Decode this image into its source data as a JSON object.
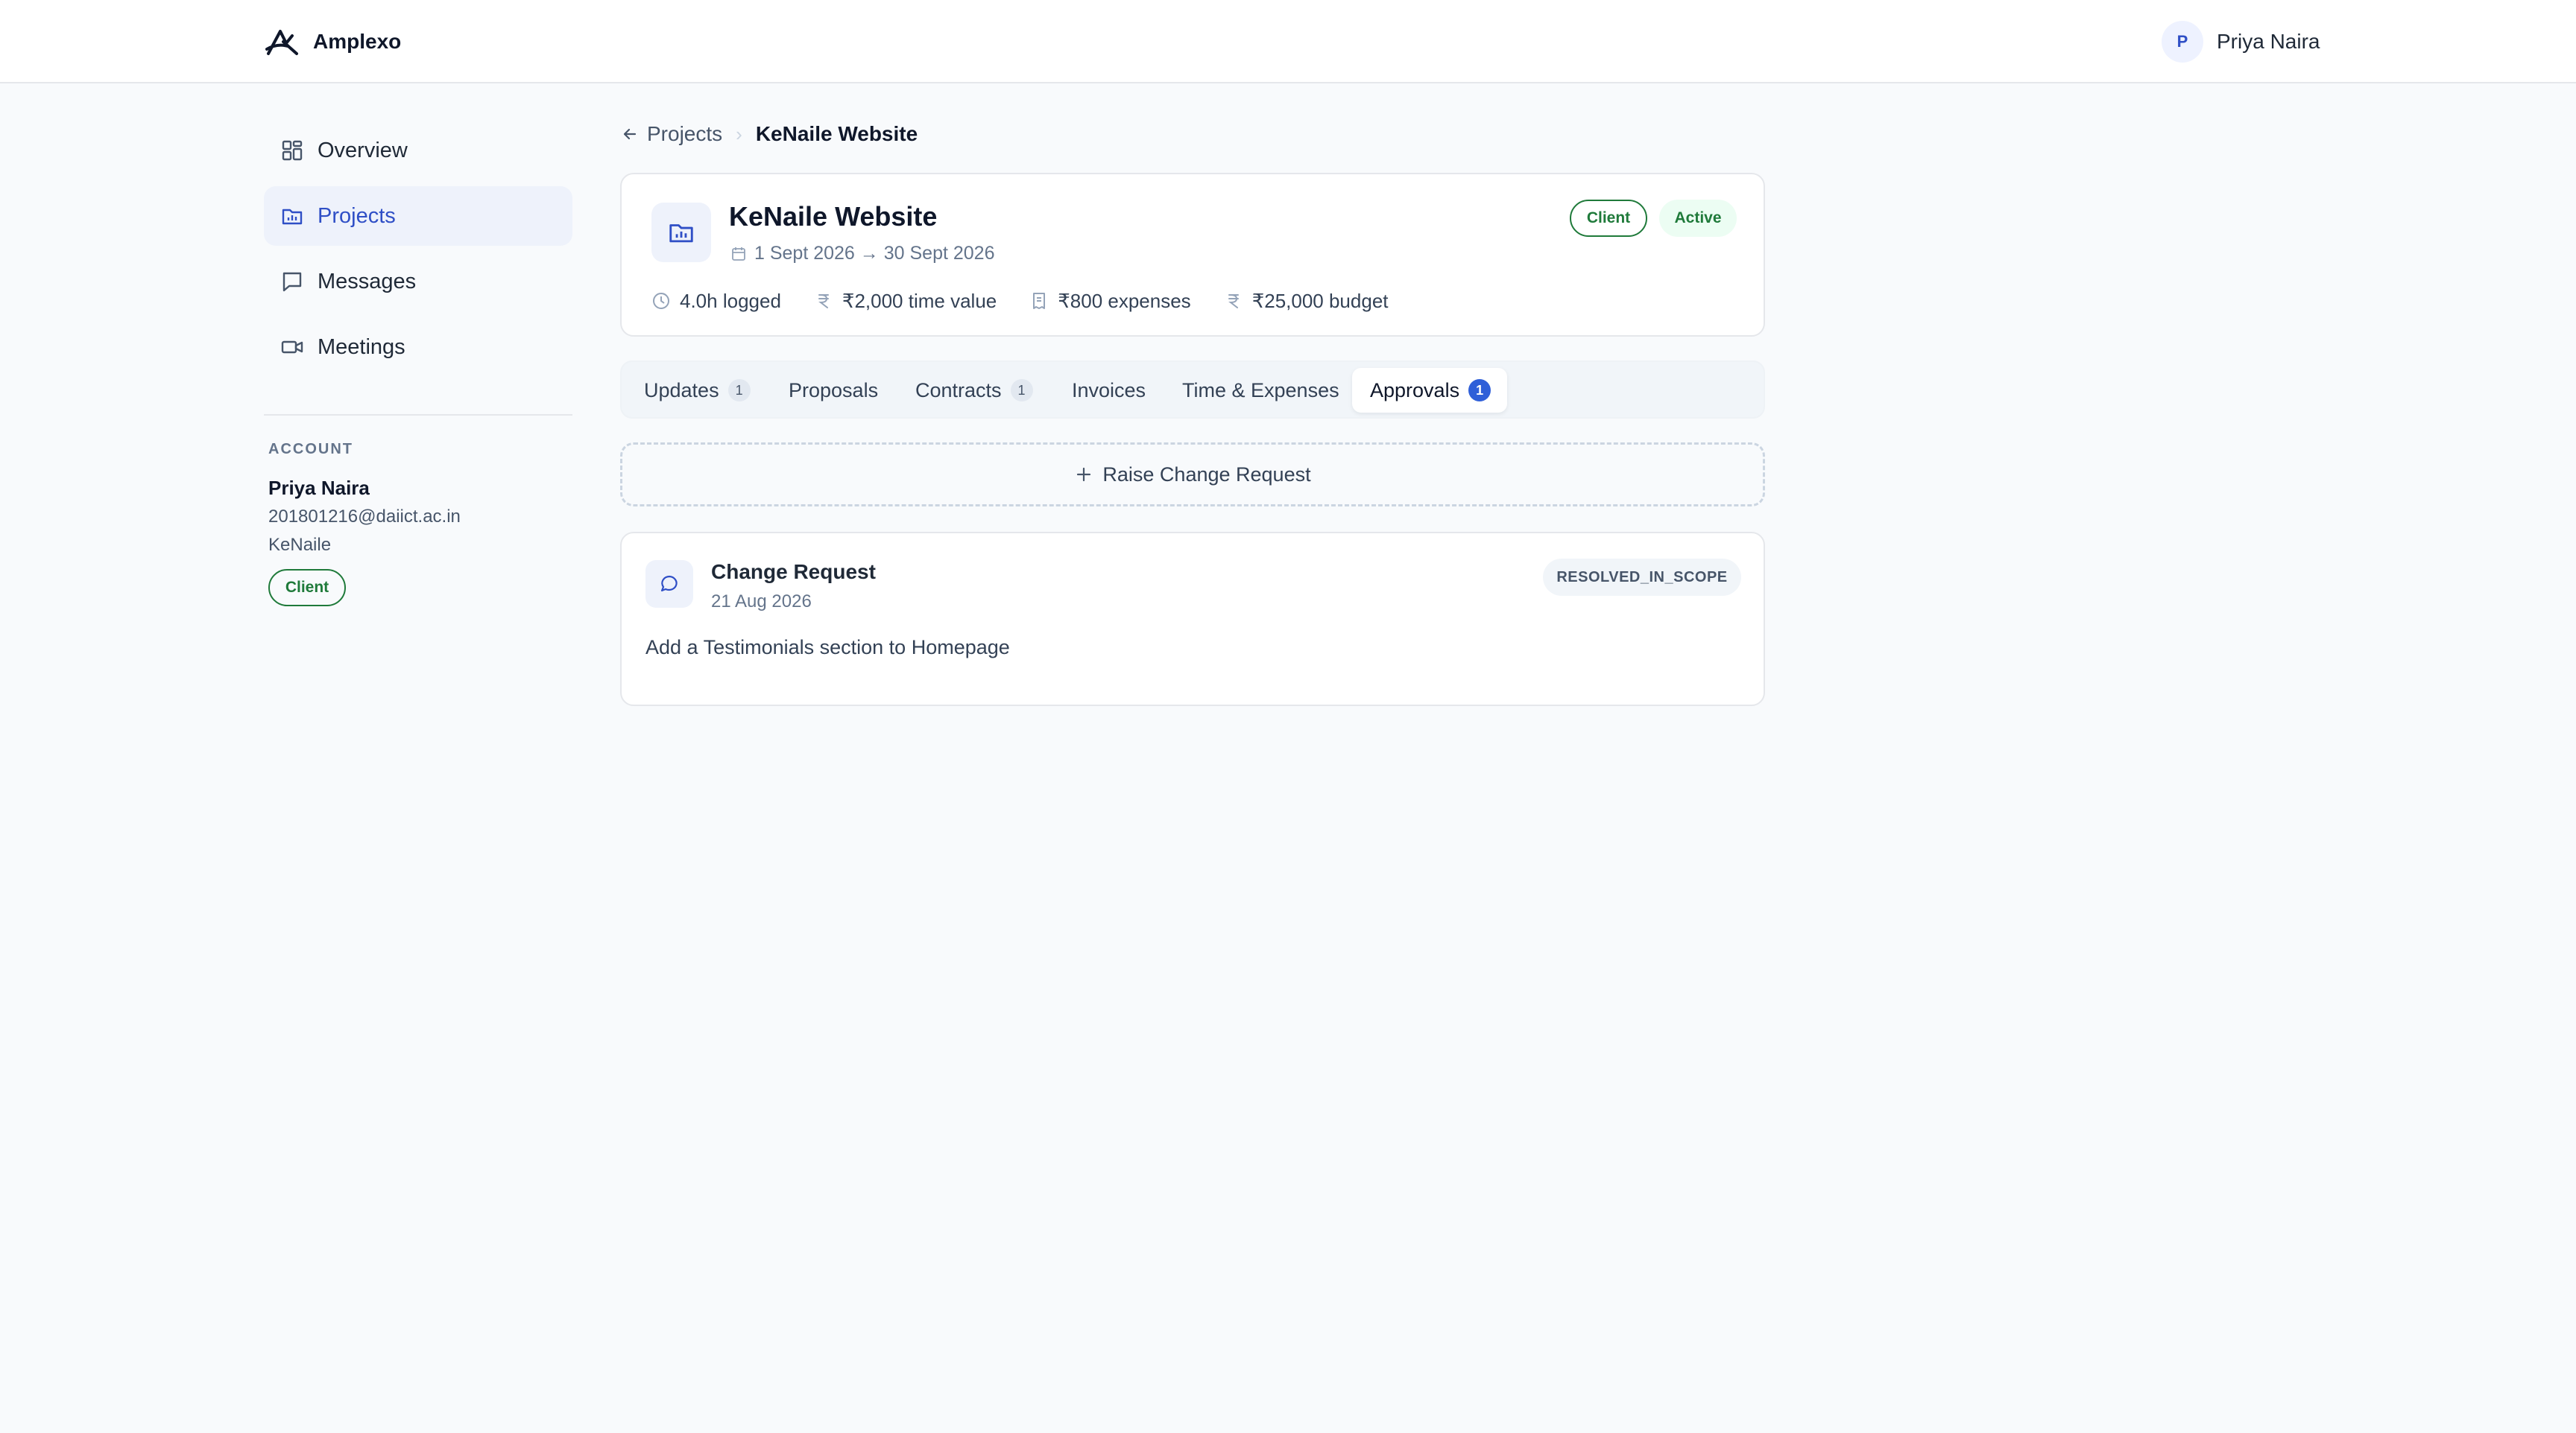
{
  "app": {
    "name": "Amplexo"
  },
  "user": {
    "initial": "P",
    "name": "Priya Naira"
  },
  "sidebar": {
    "items": [
      {
        "label": "Overview",
        "icon": "grid-icon",
        "active": false
      },
      {
        "label": "Projects",
        "icon": "folder-icon",
        "active": true
      },
      {
        "label": "Messages",
        "icon": "message-icon",
        "active": false
      },
      {
        "label": "Meetings",
        "icon": "video-icon",
        "active": false
      }
    ],
    "account": {
      "section_label": "ACCOUNT",
      "name": "Priya Naira",
      "email": "201801216@daiict.ac.in",
      "org": "KeNaile",
      "role_badge": "Client"
    }
  },
  "breadcrumb": {
    "parent": "Projects",
    "current": "KeNaile Website"
  },
  "project": {
    "title": "KeNaile Website",
    "dates": "1 Sept 2026 → 30 Sept 2026",
    "badges": {
      "role": "Client",
      "status": "Active"
    },
    "stats": {
      "logged": "4.0h logged",
      "time_value": "₹2,000 time value",
      "expenses": "₹800 expenses",
      "budget": "₹25,000 budget"
    }
  },
  "tabs": [
    {
      "label": "Updates",
      "count": "1",
      "active": false
    },
    {
      "label": "Proposals",
      "count": null,
      "active": false
    },
    {
      "label": "Contracts",
      "count": "1",
      "active": false
    },
    {
      "label": "Invoices",
      "count": null,
      "active": false
    },
    {
      "label": "Time & Expenses",
      "count": null,
      "active": false
    },
    {
      "label": "Approvals",
      "count": "1",
      "active": true
    }
  ],
  "raise_button": {
    "label": "Raise Change Request"
  },
  "change_request": {
    "title": "Change Request",
    "date": "21 Aug 2026",
    "status": "RESOLVED_IN_SCOPE",
    "description": "Add a Testimonials section to Homepage"
  },
  "colors": {
    "accent": "#2f4fc6",
    "accent_badge": "#2f5fd8",
    "success": "#1f7a3a",
    "success_bg": "#ecfdf3",
    "background": "#f8fafc"
  }
}
